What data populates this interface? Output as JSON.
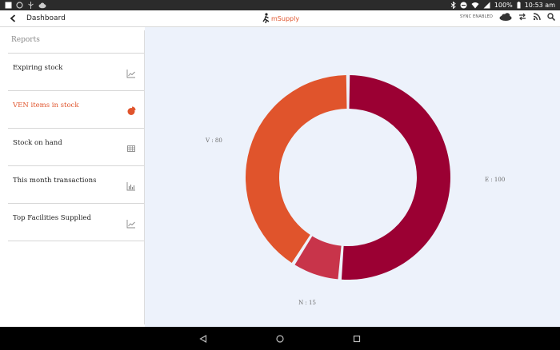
{
  "status_bar": {
    "battery": "100%",
    "time": "10:53 am"
  },
  "header": {
    "title": "Dashboard",
    "logo_text": "mSupply",
    "sync_status": "SYNC ENABLED"
  },
  "sidebar": {
    "heading": "Reports",
    "items": [
      {
        "label": "Expiring stock",
        "icon": "line-chart-icon",
        "active": false
      },
      {
        "label": "VEN items in stock",
        "icon": "pie-chart-icon",
        "active": true
      },
      {
        "label": "Stock on hand",
        "icon": "table-icon",
        "active": false
      },
      {
        "label": "This month transactions",
        "icon": "bar-chart-icon",
        "active": false
      },
      {
        "label": "Top Facilities Supplied",
        "icon": "line-chart-icon",
        "active": false
      }
    ]
  },
  "colors": {
    "accent": "#e0542c",
    "E": "#9b0033",
    "N": "#c8344a",
    "V": "#e0542c",
    "chart_bg": "#edf2fb"
  },
  "chart_data": {
    "type": "pie",
    "donut": true,
    "categories": [
      "E",
      "N",
      "V"
    ],
    "values": [
      100,
      15,
      80
    ],
    "labels": [
      "E : 100",
      "N : 15",
      "V : 80"
    ]
  }
}
